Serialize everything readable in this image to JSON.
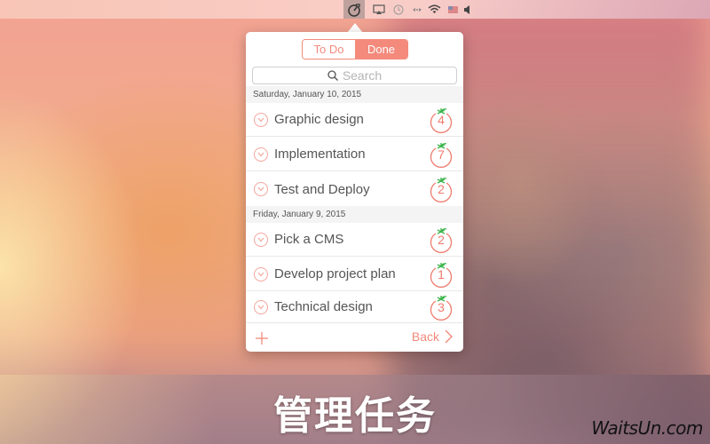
{
  "menubar": {
    "icons": [
      "timer-icon",
      "airplay-icon",
      "time-machine-icon",
      "network-arrows-icon",
      "wifi-icon",
      "flag-input-icon",
      "volume-icon"
    ]
  },
  "popover": {
    "tabs": [
      {
        "label": "To Do",
        "active": false
      },
      {
        "label": "Done",
        "active": true
      }
    ],
    "search": {
      "placeholder": "Search"
    },
    "sections": [
      {
        "date": "Saturday, January 10, 2015",
        "tasks": [
          {
            "title": "Graphic design",
            "pomodoros": "4"
          },
          {
            "title": "Implementation",
            "pomodoros": "7"
          },
          {
            "title": "Test and Deploy",
            "pomodoros": "2"
          }
        ]
      },
      {
        "date": "Friday, January 9, 2015",
        "tasks": [
          {
            "title": "Pick a CMS",
            "pomodoros": "2"
          },
          {
            "title": "Develop project plan",
            "pomodoros": "1"
          },
          {
            "title": "Technical design",
            "pomodoros": "3"
          }
        ]
      }
    ],
    "footer": {
      "back_label": "Back"
    }
  },
  "caption": "管理任务",
  "watermark": "WaitsUn.com",
  "colors": {
    "accent": "#f48a7c",
    "tomato_leaf": "#3cb44b",
    "text": "#555555"
  }
}
